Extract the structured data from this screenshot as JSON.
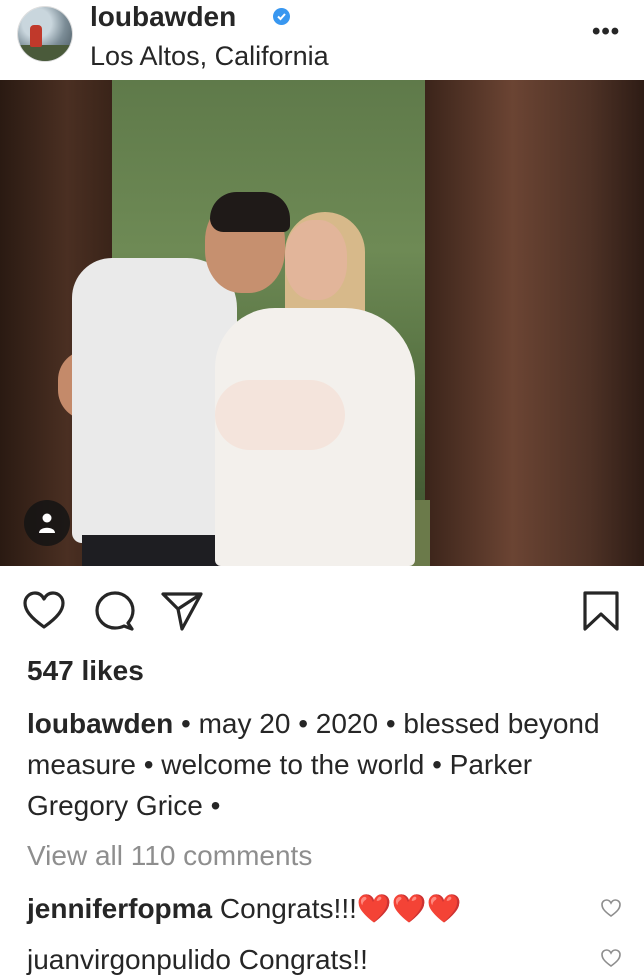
{
  "header": {
    "username": "loubawden",
    "location": "Los Altos, California",
    "more_label": "•••"
  },
  "post": {
    "likes": "547 likes",
    "caption_user": "loubawden",
    "caption_text": " • may 20 • 2020 • blessed beyond measure • welcome to the world • Parker Gregory Grice •",
    "view_comments": "View all 110 comments"
  },
  "comments": [
    {
      "user": "jenniferfopma",
      "text": " Congrats!!!",
      "emoji": "❤️❤️❤️"
    },
    {
      "user": "juanvirgonpulido",
      "text": " Congrats!!"
    }
  ],
  "icons": {
    "heart": "heart-icon",
    "comment": "comment-icon",
    "share": "share-icon",
    "bookmark": "bookmark-icon",
    "verified": "verified-badge-icon",
    "user_tag": "user-tag-icon"
  },
  "colors": {
    "verified": "#3897f0",
    "text": "#262626",
    "muted": "#8e8e8e",
    "heart": "#e3263c"
  }
}
